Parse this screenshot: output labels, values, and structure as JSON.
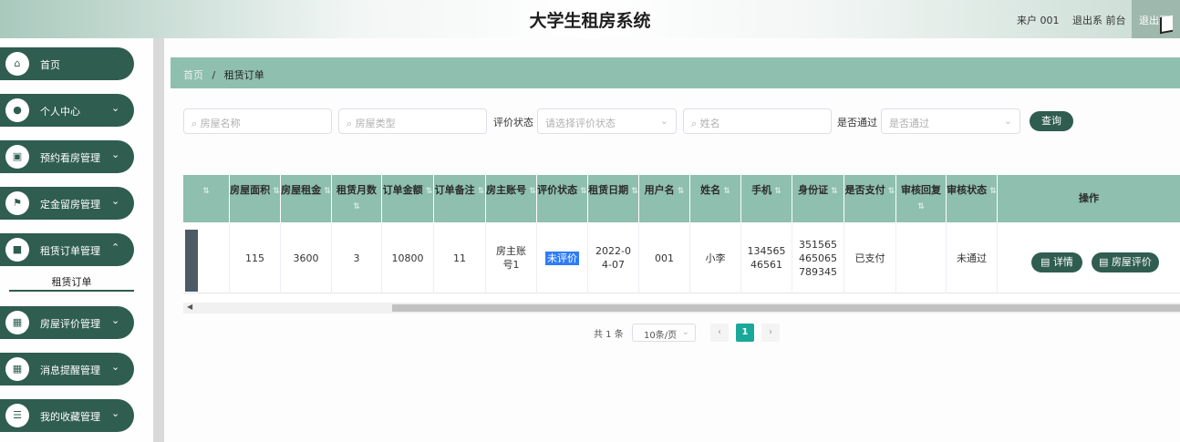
{
  "header": {
    "title": "大学生租房系统",
    "user": "来户 001",
    "role": "退出系 前台",
    "logout": "退出登"
  },
  "sidebar": {
    "items": [
      {
        "label": "首页",
        "icon": "home-icon",
        "glyph": "⌂",
        "has_chevron": false
      },
      {
        "label": "个人中心",
        "icon": "user-icon",
        "glyph": "●",
        "has_chevron": true
      },
      {
        "label": "预约看房管理",
        "icon": "clipboard-icon",
        "glyph": "▣",
        "has_chevron": true
      },
      {
        "label": "定金留房管理",
        "icon": "flag-icon",
        "glyph": "⚑",
        "has_chevron": true
      },
      {
        "label": "租赁订单管理",
        "icon": "video-icon",
        "glyph": "■",
        "has_chevron": true
      },
      {
        "label": "房屋评价管理",
        "icon": "grid-icon",
        "glyph": "▦",
        "has_chevron": true
      },
      {
        "label": "消息提醒管理",
        "icon": "grid-icon",
        "glyph": "▦",
        "has_chevron": true
      },
      {
        "label": "我的收藏管理",
        "icon": "list-icon",
        "glyph": "☰",
        "has_chevron": true
      }
    ],
    "submenu_active": "租赁订单"
  },
  "breadcrumb": {
    "home": "首页",
    "separator": "/",
    "current": "租赁订单"
  },
  "search": {
    "house_name_placeholder": "房屋名称",
    "house_type_placeholder": "房屋类型",
    "eval_status_label": "评价状态",
    "eval_status_placeholder": "请选择评价状态",
    "name_placeholder": "姓名",
    "approved_label": "是否通过",
    "approved_placeholder": "是否通过",
    "query_label": "查询"
  },
  "table": {
    "headers": [
      "房屋面积",
      "房屋租金",
      "租赁月数",
      "订单金额",
      "订单备注",
      "房主账号",
      "评价状态",
      "租赁日期",
      "用户名",
      "姓名",
      "手机",
      "身份证",
      "是否支付",
      "审核回复",
      "审核状态",
      "操作"
    ],
    "rows": [
      {
        "area": "115",
        "rent": "3600",
        "months": "3",
        "amount": "10800",
        "note": "11",
        "owner": "房主账号1",
        "eval_status": "未评价",
        "date": "2022-04-07",
        "username": "001",
        "name": "小李",
        "phone": "13456546561",
        "id_card": "351565465065789345",
        "paid": "已支付",
        "reply": "",
        "audit": "未通过"
      }
    ],
    "actions": {
      "detail": "详情",
      "review": "房屋评价"
    }
  },
  "pagination": {
    "total": "共 1 条",
    "page_size": "10条/页",
    "current_page": "1",
    "prev": "‹",
    "next": "›"
  },
  "colors": {
    "primary": "#2f5d50",
    "header_bg": "#8fbfae",
    "active_page": "#1aa89a"
  }
}
